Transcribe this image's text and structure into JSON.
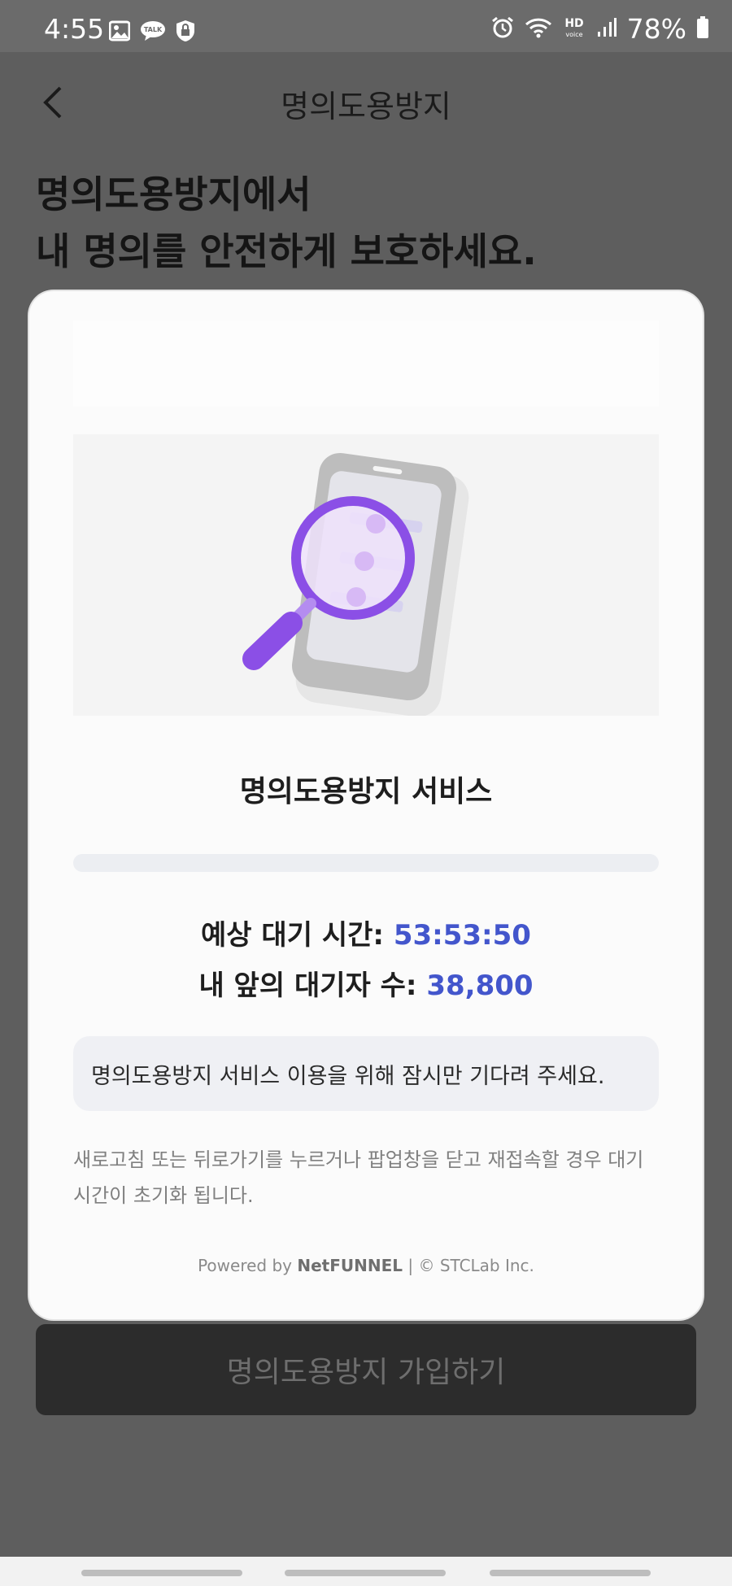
{
  "status_bar": {
    "time": "4:55",
    "left_icons": [
      "gallery-icon",
      "kakaotalk-icon",
      "vpn-shield-icon"
    ],
    "right_icons": [
      "alarm-icon",
      "wifi-icon",
      "hd-voice-icon",
      "signal-icon",
      "battery-icon"
    ],
    "battery_percent": "78%"
  },
  "header": {
    "back_icon": "chevron-left-icon",
    "title": "명의도용방지"
  },
  "headline": {
    "line1": "명의도용방지에서",
    "line2": "내 명의를 안전하게 보호하세요."
  },
  "modal": {
    "illustration": "magnifier-over-phone-illustration",
    "service_title": "명의도용방지 서비스",
    "progress": 0.0,
    "wait_time_label": "예상 대기 시간: ",
    "wait_time_value": "53:53:50",
    "queue_label": "내 앞의 대기자 수: ",
    "queue_value": "38,800",
    "notice": "명의도용방지 서비스 이용을 위해 잠시만 기다려 주세요.",
    "warning_line1": "새로고침 또는 뒤로가기를 누르거나 팝업창을 닫고 재접속할 경우 대기",
    "warning_line2": "시간이 초기화 됩니다.",
    "powered_prefix": "Powered by ",
    "powered_brand": "NetFUNNEL",
    "powered_suffix": " | © STCLab Inc."
  },
  "bottom_button": {
    "label": "명의도용방지 가입하기"
  },
  "colors": {
    "accent_value": "#4356cc",
    "button_bg": "#2c2c2c",
    "illustration_purple": "#8b4fe6"
  }
}
